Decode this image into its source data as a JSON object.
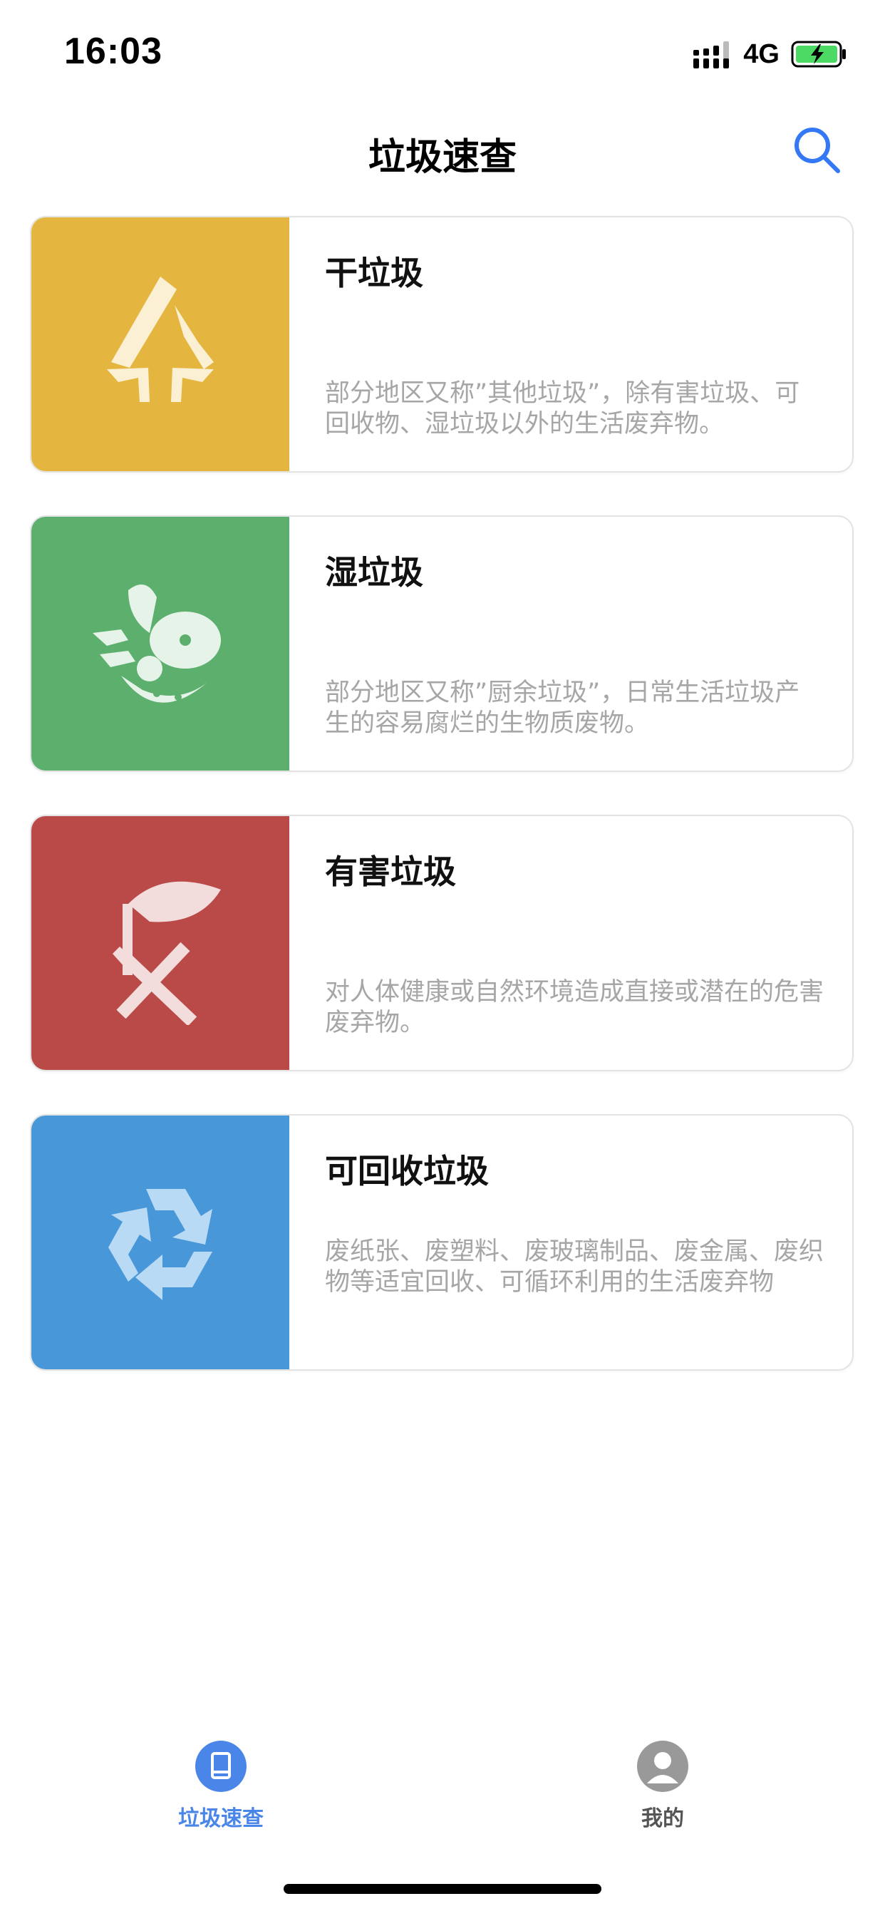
{
  "status_bar": {
    "time": "16:03",
    "network": "4G",
    "battery_color": "#4cd964"
  },
  "nav": {
    "title": "垃圾速查",
    "search_icon": "search-icon",
    "accent_color": "#3478f6"
  },
  "categories": [
    {
      "title": "干垃圾",
      "description": "部分地区又称”其他垃圾”，除有害垃圾、可回收物、湿垃圾以外的生活废弃物。",
      "color": "#e4b63f",
      "icon": "dry-waste-icon"
    },
    {
      "title": "湿垃圾",
      "description": "部分地区又称”厨余垃圾”，日常生活垃圾产生的容易腐烂的生物质废物。",
      "color": "#5daf6e",
      "icon": "wet-waste-icon"
    },
    {
      "title": "有害垃圾",
      "description": "对人体健康或自然环境造成直接或潜在的危害废弃物。",
      "color": "#b94a48",
      "icon": "hazardous-waste-icon"
    },
    {
      "title": "可回收垃圾",
      "description": "废纸张、废塑料、废玻璃制品、废金属、废织物等适宜回收、可循环利用的生活废弃物",
      "color": "#4897d8",
      "icon": "recycle-icon"
    }
  ],
  "tab_bar": {
    "tabs": [
      {
        "label": "垃圾速查",
        "icon": "book-icon",
        "active": true
      },
      {
        "label": "我的",
        "icon": "user-icon",
        "active": false
      }
    ],
    "active_color": "#4a86e8",
    "inactive_color": "#999999"
  }
}
